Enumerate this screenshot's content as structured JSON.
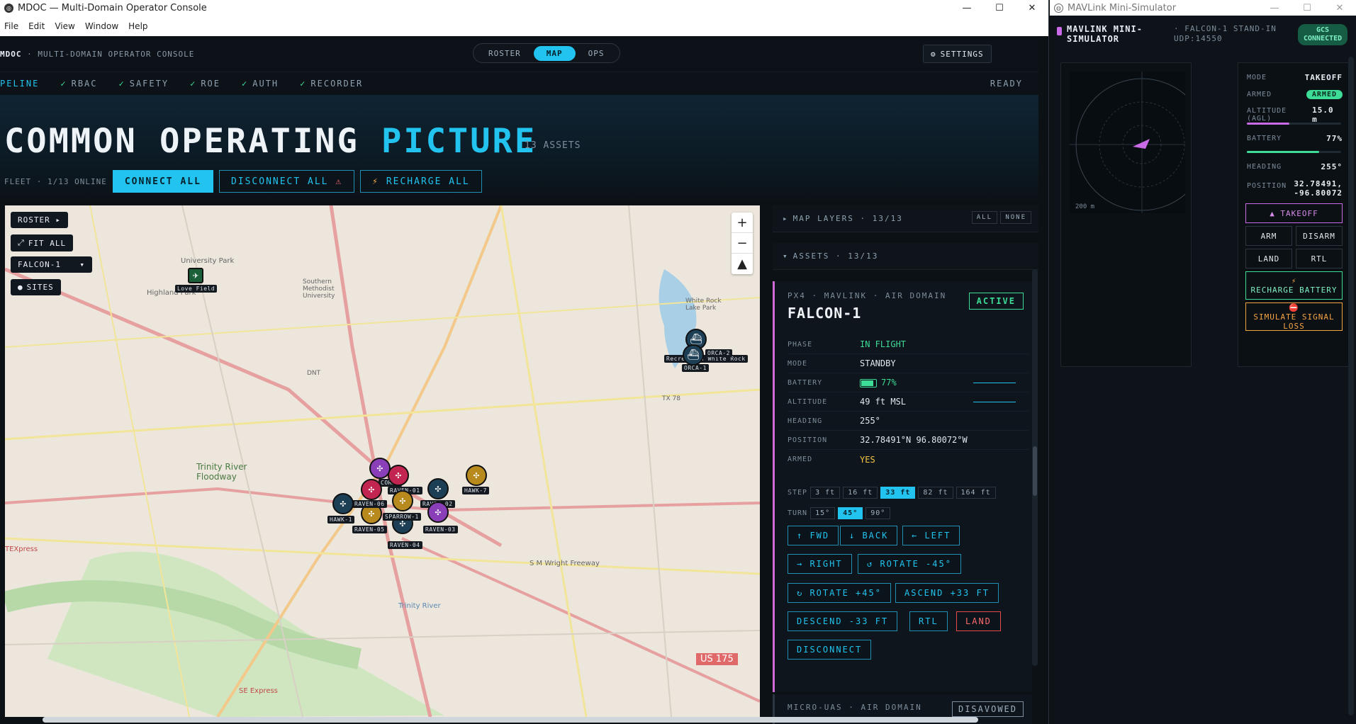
{
  "console": {
    "title": "MDOC — Multi-Domain Operator Console",
    "menu": [
      "File",
      "Edit",
      "View",
      "Window",
      "Help"
    ],
    "brand": "MDOC",
    "brand_sub": "· MULTI-DOMAIN OPERATOR CONSOLE",
    "tabs": [
      "ROSTER",
      "MAP",
      "OPS"
    ],
    "active_tab": "MAP",
    "settings": "SETTINGS",
    "pipeline": {
      "lead": "PELINE",
      "items": [
        "RBAC",
        "SAFETY",
        "ROE",
        "AUTH",
        "RECORDER"
      ],
      "status": "READY"
    },
    "hero": {
      "title_a": "COMMON OPERATING",
      "title_b": "PICTURE",
      "count": "13 ASSETS"
    },
    "fleet": {
      "label": "FLEET · 1/13 ONLINE",
      "connect": "CONNECT ALL",
      "disconnect": "DISCONNECT ALL",
      "recharge": "RECHARGE ALL"
    },
    "map": {
      "roster": "ROSTER ▸",
      "fit": "FIT ALL",
      "select": "FALCON-1",
      "sites": "SITES",
      "places": [
        "Love Field",
        "University Park",
        "Highland Park",
        "Southern Methodist University",
        "White Rock Lake Park",
        "Trinity River Floodway",
        "Trinity River",
        "S M Wright Freeway",
        "US 175",
        "TX 78",
        "DNT",
        "TEXpress",
        "SE Express",
        "Recreation White Rock"
      ],
      "markers": [
        "CORAL",
        "RAVEN-01",
        "RAVEN-02",
        "RAVEN-03",
        "RAVEN-04",
        "RAVEN-05",
        "RAVEN-06",
        "HAWK-1",
        "HAWK-7",
        "SPARROW-1",
        "ORCA-1",
        "ORCA-2"
      ]
    },
    "layers": {
      "label": "MAP LAYERS · 13/13",
      "all": "ALL",
      "none": "NONE"
    },
    "assets": {
      "label": "ASSETS · 13/13"
    },
    "card": {
      "kicker": "PX4 · MAVLINK · AIR DOMAIN",
      "name": "FALCON-1",
      "status": "ACTIVE",
      "rows": [
        {
          "k": "PHASE",
          "v": "IN FLIGHT"
        },
        {
          "k": "MODE",
          "v": "STANDBY"
        },
        {
          "k": "BATTERY",
          "v": "77%"
        },
        {
          "k": "ALTITUDE",
          "v": "49 ft MSL"
        },
        {
          "k": "HEADING",
          "v": "255°"
        },
        {
          "k": "POSITION",
          "v": "32.78491°N 96.80072°W"
        },
        {
          "k": "ARMED",
          "v": "YES"
        }
      ],
      "battery_level": 0.77,
      "step_label": "STEP",
      "steps": [
        "3 ft",
        "16 ft",
        "33 ft",
        "82 ft",
        "164 ft"
      ],
      "step_active": "33 ft",
      "turn_label": "TURN",
      "turns": [
        "15°",
        "45°",
        "90°"
      ],
      "turn_active": "45°",
      "buttons": {
        "fwd": "↑ FWD",
        "back": "↓ BACK",
        "left": "← LEFT",
        "right": "→ RIGHT",
        "rotl": "↺ ROTATE -45°",
        "rotr": "↻ ROTATE +45°",
        "asc": "ASCEND +33 FT",
        "desc": "DESCEND -33 FT",
        "rtl": "RTL",
        "land": "LAND",
        "disc": "DISCONNECT"
      }
    },
    "card2": {
      "kicker": "MICRO-UAS · AIR DOMAIN",
      "status": "DISAVOWED"
    }
  },
  "sim": {
    "title": "MAVLink Mini-Simulator",
    "head": "MAVLINK MINI-SIMULATOR",
    "sub": "· FALCON-1 STAND-IN UDP:14550",
    "gcs": "GCS CONNECTED",
    "range": "200 m",
    "mode_k": "MODE",
    "mode_v": "TAKEOFF",
    "armed_k": "ARMED",
    "armed_v": "ARMED",
    "alt_k": "ALTITUDE (AGL)",
    "alt_v": "15.0 m",
    "alt_level": 0.45,
    "bat_k": "BATTERY",
    "bat_v": "77%",
    "bat_level": 0.77,
    "hdg_k": "HEADING",
    "hdg_v": "255°",
    "pos_k": "POSITION",
    "pos_v1": "32.78491,",
    "pos_v2": "-96.80072",
    "takeoff": "▲ TAKEOFF",
    "arm": "ARM",
    "disarm": "DISARM",
    "land": "LAND",
    "rtl": "RTL",
    "recharge": "RECHARGE BATTERY",
    "signal": "SIMULATE SIGNAL LOSS",
    "colors": {
      "accent": "#22c3ee",
      "ok": "#3ddc97",
      "sim": "#c96ae6",
      "warn": "#f5a442"
    }
  }
}
